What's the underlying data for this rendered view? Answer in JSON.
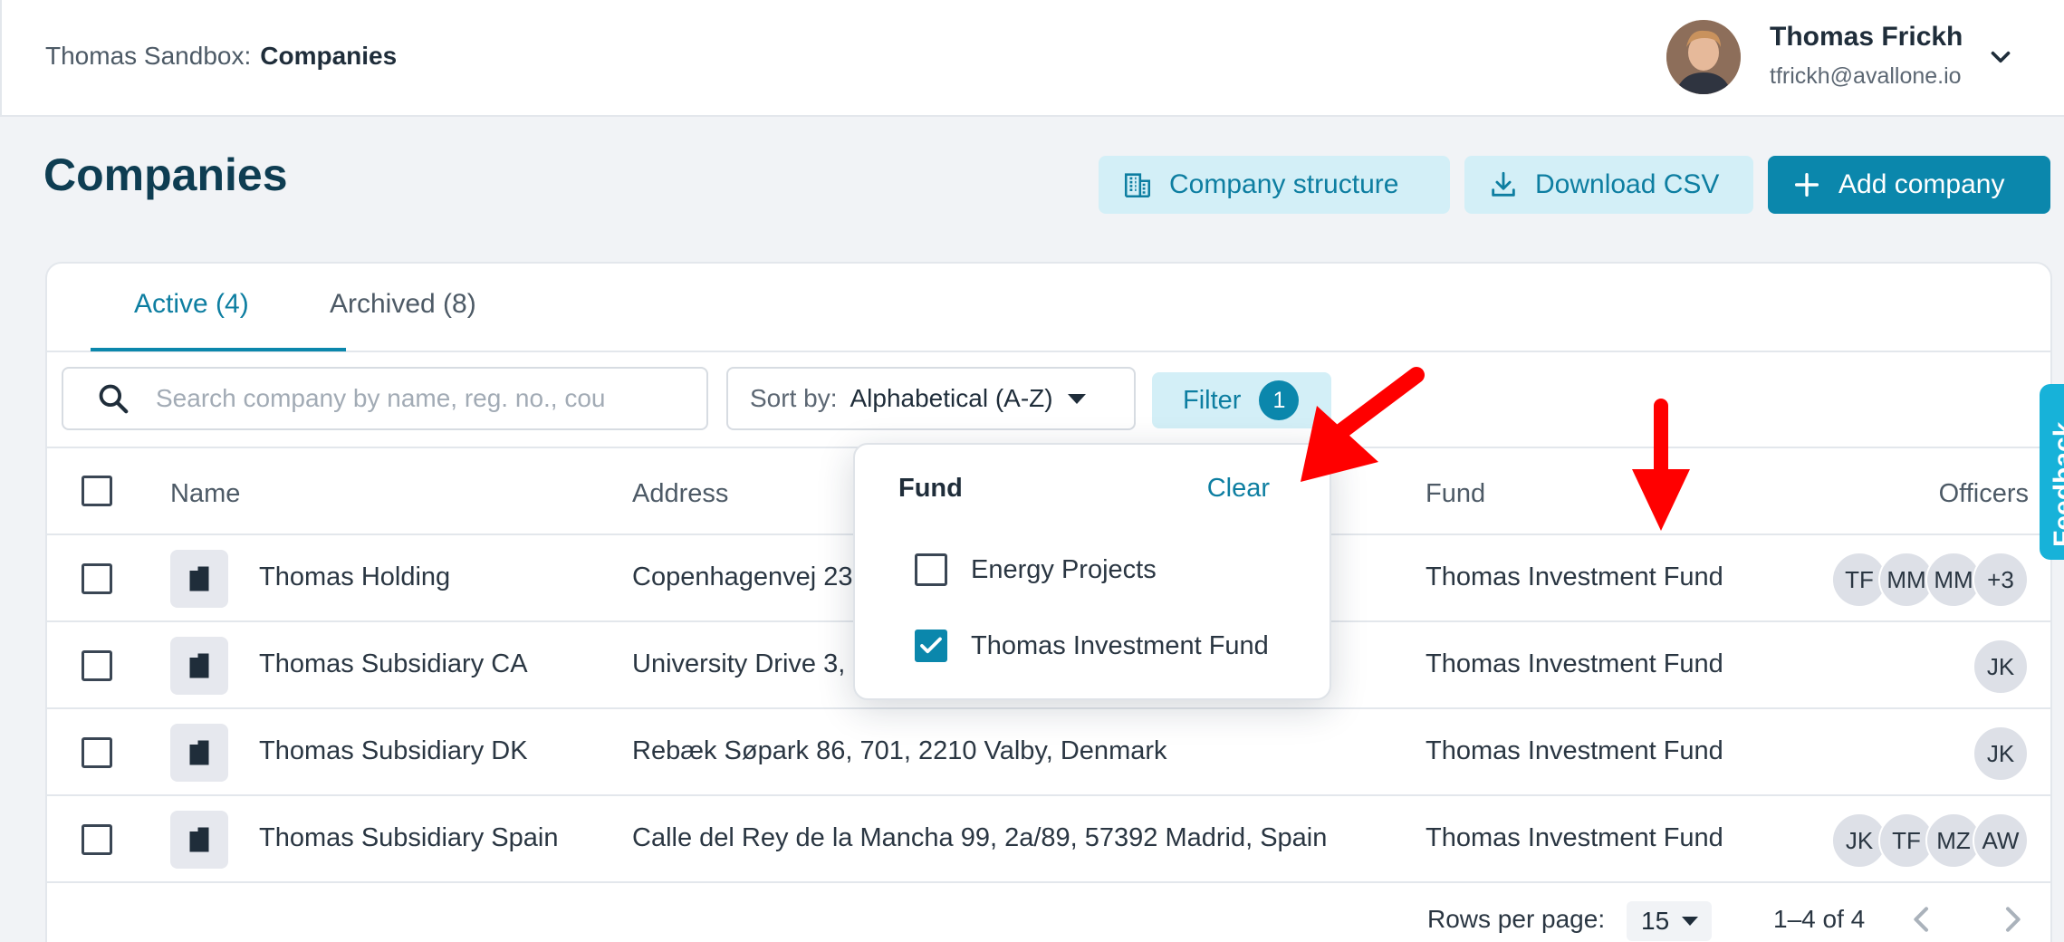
{
  "header": {
    "workspace": "Thomas Sandbox:",
    "section": "Companies",
    "user_name": "Thomas Frickh",
    "user_email": "tfrickh@avallone.io"
  },
  "page": {
    "title": "Companies",
    "buttons": {
      "company_structure": "Company structure",
      "download_csv": "Download CSV",
      "add_company": "Add company"
    }
  },
  "tabs": [
    {
      "label": "Active (4)",
      "active": true
    },
    {
      "label": "Archived (8)",
      "active": false
    }
  ],
  "toolbar": {
    "search_placeholder": "Search company by name, reg. no., cou",
    "sort_label": "Sort by:",
    "sort_value": "Alphabetical (A-Z)",
    "filter_label": "Filter",
    "filter_count": "1"
  },
  "table": {
    "columns": {
      "name": "Name",
      "address": "Address",
      "fund": "Fund",
      "officers": "Officers"
    },
    "rows": [
      {
        "name": "Thomas Holding",
        "address": "Copenhagenvej 23",
        "fund": "Thomas Investment Fund",
        "officers": [
          "TF",
          "MM",
          "MM",
          "+3"
        ]
      },
      {
        "name": "Thomas Subsidiary CA",
        "address": "University Drive 3,",
        "fund": "Thomas Investment Fund",
        "officers": [
          "JK"
        ]
      },
      {
        "name": "Thomas Subsidiary DK",
        "address": "Rebæk Søpark 86, 701, 2210 Valby, Denmark",
        "fund": "Thomas Investment Fund",
        "officers": [
          "JK"
        ]
      },
      {
        "name": "Thomas Subsidiary Spain",
        "address": "Calle del Rey de la Mancha 99, 2a/89, 57392 Madrid, Spain",
        "fund": "Thomas Investment Fund",
        "officers": [
          "JK",
          "TF",
          "MZ",
          "AW"
        ]
      }
    ]
  },
  "pagination": {
    "rows_per_page_label": "Rows per page:",
    "rows_per_page_value": "15",
    "range": "1–4 of 4"
  },
  "filter_dropdown": {
    "title": "Fund",
    "clear_label": "Clear",
    "options": [
      {
        "label": "Energy Projects",
        "checked": false
      },
      {
        "label": "Thomas Investment Fund",
        "checked": true
      }
    ]
  },
  "feedback_label": "Feedback",
  "colors": {
    "accent": "#0b87ac",
    "accent_light": "#d3eff7",
    "title": "#0e3d52",
    "annotation": "#ff0000"
  }
}
